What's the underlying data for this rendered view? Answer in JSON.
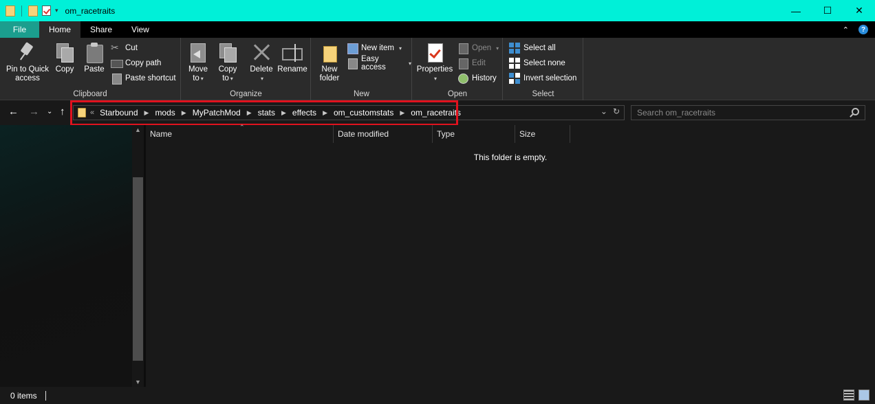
{
  "window": {
    "title": "om_racetraits",
    "controls": {
      "minimize": "—",
      "maximize": "☐",
      "close": "✕"
    }
  },
  "tabs": [
    "File",
    "Home",
    "Share",
    "View"
  ],
  "ribbon": {
    "clipboard": {
      "label": "Clipboard",
      "pin": [
        "Pin to Quick",
        "access"
      ],
      "copy": "Copy",
      "paste": "Paste",
      "cut": "Cut",
      "copy_path": "Copy path",
      "paste_shortcut": "Paste shortcut"
    },
    "organize": {
      "label": "Organize",
      "move_to": [
        "Move",
        "to"
      ],
      "copy_to": [
        "Copy",
        "to"
      ],
      "delete": "Delete",
      "rename": "Rename"
    },
    "new": {
      "label": "New",
      "new_folder": [
        "New",
        "folder"
      ],
      "new_item": "New item",
      "easy_access": "Easy access"
    },
    "open": {
      "label": "Open",
      "properties": "Properties",
      "open": "Open",
      "edit": "Edit",
      "history": "History"
    },
    "select": {
      "label": "Select",
      "select_all": "Select all",
      "select_none": "Select none",
      "invert_selection": "Invert selection"
    }
  },
  "address": {
    "overflow": "«",
    "crumbs": [
      "Starbound",
      "mods",
      "MyPatchMod",
      "stats",
      "effects",
      "om_customstats",
      "om_racetraits"
    ]
  },
  "search": {
    "placeholder": "Search om_racetraits"
  },
  "columns": [
    "Name",
    "Date modified",
    "Type",
    "Size"
  ],
  "empty_message": "This folder is empty.",
  "status": {
    "items": "0 items"
  },
  "colors": {
    "title_bar": "#00f0d8",
    "file_tab": "#1b9e8e",
    "highlight": "#e0121e",
    "background": "#191919"
  }
}
